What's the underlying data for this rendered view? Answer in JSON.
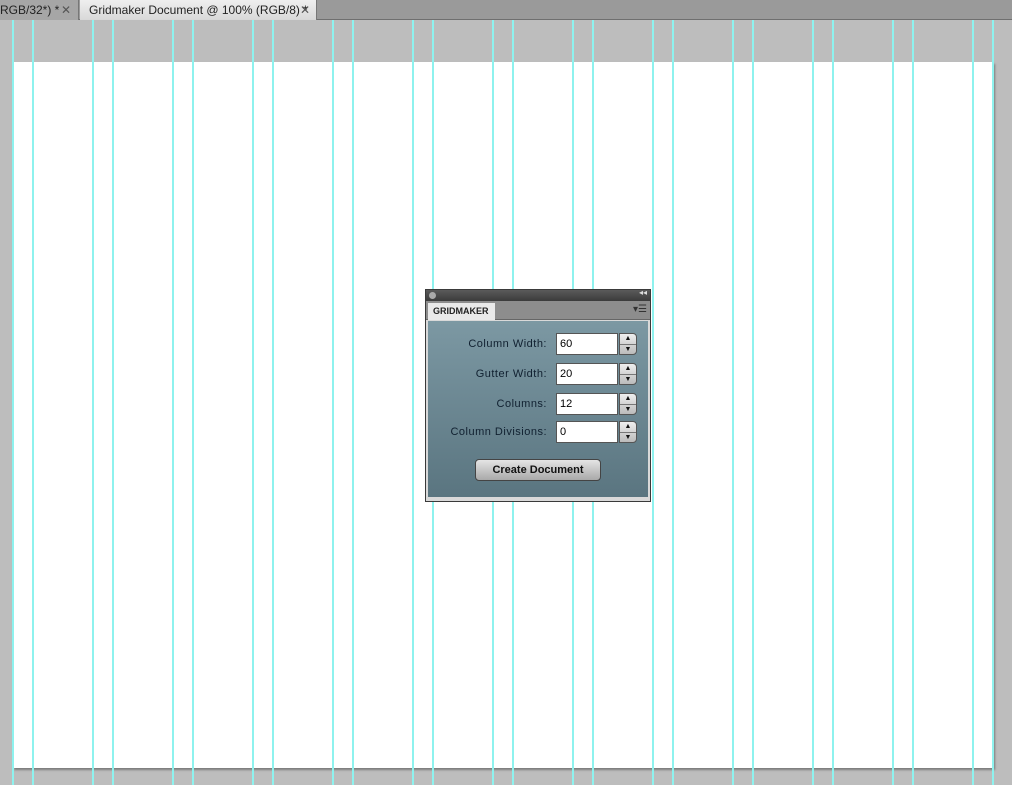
{
  "tabs": [
    {
      "label": "RGB/32*) *",
      "close": "✕"
    },
    {
      "label": "Gridmaker Document @ 100% (RGB/8) *",
      "close": "✕"
    }
  ],
  "panel": {
    "tab": "GRIDMAKER",
    "collapse": "◂◂",
    "menu": "▾☰",
    "fields": [
      {
        "label": "Column Width:",
        "value": "60"
      },
      {
        "label": "Gutter Width:",
        "value": "20"
      },
      {
        "label": "Columns:",
        "value": "12"
      },
      {
        "label": "Column Divisions:",
        "value": "0"
      }
    ],
    "spin_up": "▲",
    "spin_down": "▼",
    "button": "Create Document"
  },
  "colors": {
    "guide": "#8ef2ee",
    "panel_bg": "#6b8792"
  }
}
